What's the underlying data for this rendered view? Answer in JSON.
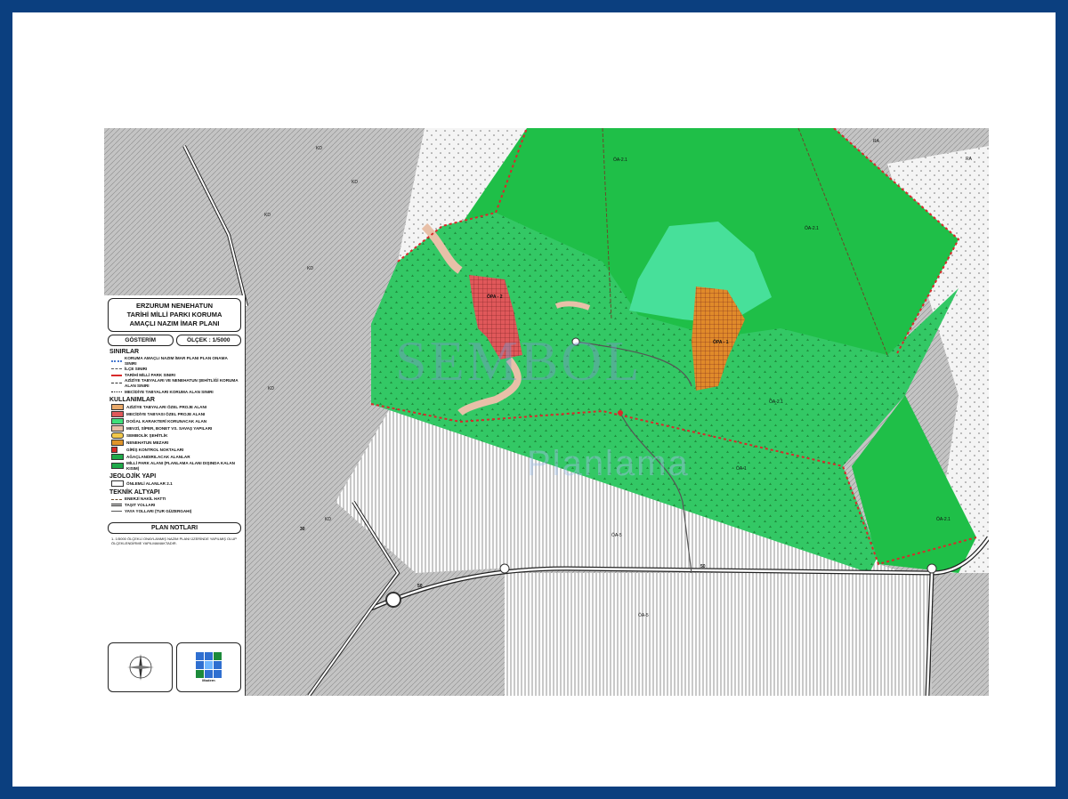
{
  "legend": {
    "title_lines": [
      "ERZURUM NENEHATUN",
      "TARİHİ MİLLİ PARKI KORUMA",
      "AMAÇLI NAZIM İMAR PLANI"
    ],
    "gosterim": "GÖSTERİM",
    "olcek": "ÖLÇEK : 1/5000",
    "sinirlar_title": "SINIRLAR",
    "sinirlar": [
      "KORUMA AMAÇLI NAZIM İMAR PLANI PLAN ONAMA SINIRI",
      "İLÇE SINIRI",
      "TARİHİ MİLLİ PARK SINIRI",
      "AZİZİYE TABYALARI VE NENEHATUN ŞEHİTLİĞİ KORUMA ALAN SINIRI",
      "MECİDİYE TABYALARI KORUMA ALAN SINIRI"
    ],
    "kullanimlar_title": "KULLANIMLAR",
    "kullanimlar": [
      {
        "label": "AZİZİYE TABYALARI ÖZEL PROJE ALANI",
        "color": "#e8a96a"
      },
      {
        "label": "MECİDİYE TABYASI ÖZEL PROJE ALANI",
        "color": "#e0585a"
      },
      {
        "label": "DOĞAL KARAKTERİ KORUNACAK ALAN",
        "color": "#3fe07a"
      },
      {
        "label": "MEVZİ, SİPER, BONET VS. SAVAŞ YAPILARI",
        "color": "#e8c0a8"
      },
      {
        "label": "SEMBOLİK ŞEHİTLİK",
        "color": "#f2c84a"
      },
      {
        "label": "NENEHATUN MEZARI",
        "color": "#e0942a"
      },
      {
        "label": "GİRİŞ KONTROL NOKTALARI",
        "color": "#d82a2a"
      },
      {
        "label": "AĞAÇLANDIRILACAK ALANLAR",
        "color": "#1faa4a"
      },
      {
        "label": "MİLLİ PARK ALANI (PLANLAMA ALANI DIŞINDA KALAN KISIM)",
        "color": "#ffffff"
      }
    ],
    "jeolojik_title": "JEOLOJİK YAPI",
    "jeolojik_item": "ÖNLEMLİ ALANLAR 2.1",
    "teknik_title": "TEKNİK ALTYAPI",
    "teknik": [
      "ENERJİ NAKİL HATTI",
      "TAŞIT YOLLARI",
      "YAYA YOLLARI (TUR GÜZERGAHI)"
    ],
    "plan_notlari": "PLAN NOTLARI",
    "plan_note_text": "1- 1/5000 ÖLÇEKLİ ONAYLANMIŞ NAZIM PLANI ÜZERİNDE YAPILMIŞ OLUP ÖLÇEKLENDİRME YAPILMAMAKTADIR.",
    "logo_caption": "Modern"
  },
  "map_labels": {
    "opa1": "ÖPA - 1",
    "opa2": "ÖPA - 2",
    "kd": "KD",
    "oa21": "ÖA-2.1",
    "oa1": "ÖA-1",
    "oa5": "ÖA-5",
    "ra": "RA",
    "road50": "50",
    "road30": "30"
  },
  "watermark": {
    "line1": "SEMBOL",
    "line2": "Planlama"
  },
  "colors": {
    "border": "#0b3f7f",
    "forest": "#1fbf48",
    "natural": "#3dd26a",
    "light_green": "#47e09a",
    "red_project": "#e0585a",
    "orange_project": "#e08a2a",
    "boundary_red": "#d82a2a"
  }
}
